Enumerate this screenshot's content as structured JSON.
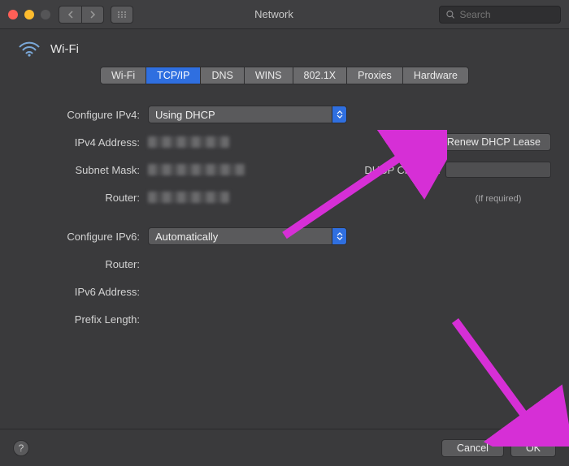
{
  "window": {
    "title": "Network",
    "search_placeholder": "Search",
    "traffic_colors": {
      "close": "#ff5f57",
      "min": "#febc2e",
      "max": "#555557"
    }
  },
  "header": {
    "interface_name": "Wi-Fi"
  },
  "tabs": [
    {
      "label": "Wi-Fi",
      "active": false
    },
    {
      "label": "TCP/IP",
      "active": true
    },
    {
      "label": "DNS",
      "active": false
    },
    {
      "label": "WINS",
      "active": false
    },
    {
      "label": "802.1X",
      "active": false
    },
    {
      "label": "Proxies",
      "active": false
    },
    {
      "label": "Hardware",
      "active": false
    }
  ],
  "ipv4": {
    "configure_label": "Configure IPv4:",
    "configure_value": "Using DHCP",
    "address_label": "IPv4 Address:",
    "subnet_label": "Subnet Mask:",
    "router_label": "Router:",
    "renew_button": "Renew DHCP Lease",
    "dhcp_client_id_label": "DHCP Client ID:",
    "if_required": "(If required)"
  },
  "ipv6": {
    "configure_label": "Configure IPv6:",
    "configure_value": "Automatically",
    "router_label": "Router:",
    "address_label": "IPv6 Address:",
    "prefix_label": "Prefix Length:"
  },
  "footer": {
    "help": "?",
    "cancel": "Cancel",
    "ok": "OK"
  },
  "annotation": {
    "arrow_color": "#d62fd6"
  }
}
